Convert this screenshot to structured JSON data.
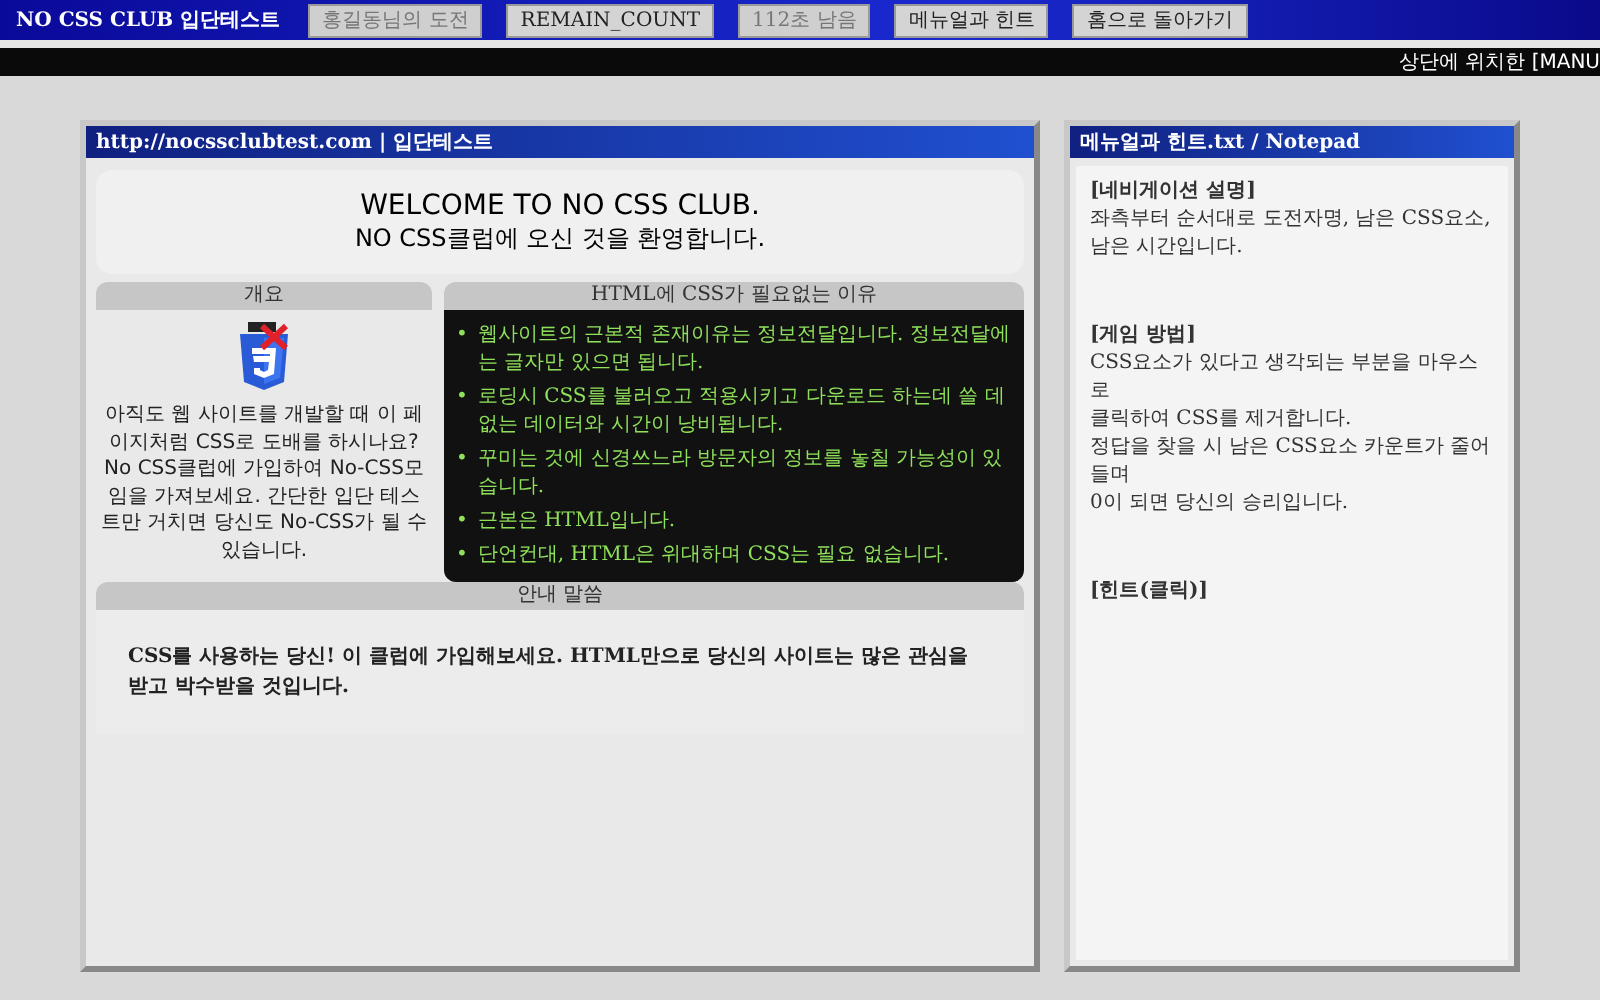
{
  "top_bar": {
    "title": "NO CSS CLUB 입단테스트",
    "buttons": [
      {
        "label": "홍길동님의 도전",
        "disabled": true
      },
      {
        "label": "REMAIN_COUNT",
        "disabled": false
      },
      {
        "label": "112초 남음",
        "disabled": true
      },
      {
        "label": "메뉴얼과 힌트",
        "disabled": false
      },
      {
        "label": "홈으로 돌아가기",
        "disabled": false
      }
    ]
  },
  "marquee": "상단에 위치한 [MANU",
  "main_window": {
    "title": "http://nocssclubtest.com | 입단테스트",
    "welcome": [
      "WELCOME TO NO CSS CLUB.",
      "NO CSS클럽에 오신 것을 환영합니다."
    ],
    "overview": {
      "heading": "개요",
      "text": "아직도 웹 사이트를 개발할 때 이 페이지처럼 CSS로 도배를 하시나요? No CSS클럽에 가입하여 No-CSS모임을 가져보세요. 간단한 입단 테스트만 거치면 당신도 No-CSS가 될 수 있습니다."
    },
    "reasons": {
      "heading": "HTML에 CSS가 필요없는 이유",
      "items": [
        {
          "marker": "•",
          "text": "웹사이트의 근본적 존재이유는 정보전달입니다. 정보전달에는 글자만 있으면 됩니다."
        },
        {
          "marker": "•",
          "text": "로딩시 CSS를 불러오고 적용시키고 다운로드 하는데 쓸 데 없는 데이터와 시간이 낭비됩니다."
        },
        {
          "marker": "•",
          "text": "꾸미는 것에 신경쓰느라 방문자의 정보를 놓칠 가능성이 있습니다."
        },
        {
          "marker": "•",
          "text": "근본은 HTML입니다."
        },
        {
          "marker": "•",
          "text": "단언컨대, HTML은 위대하며 CSS는 필요 없습니다."
        }
      ]
    },
    "notice": {
      "heading": "안내 말씀",
      "text": "CSS를 사용하는 당신! 이 클럽에 가입해보세요. HTML만으로 당신의 사이트는 많은 관심을 받고 박수받을 것입니다."
    }
  },
  "notepad": {
    "title": "메뉴얼과 힌트.txt / Notepad",
    "sections": [
      {
        "heading": "[네비게이션 설명]",
        "lines": [
          "좌측부터 순서대로 도전자명, 남은 CSS요소,",
          "남은 시간입니다."
        ]
      },
      {
        "heading": "[게임 방법]",
        "lines": [
          "CSS요소가 있다고 생각되는 부분을 마우스로",
          "클릭하여 CSS를 제거합니다.",
          "정답을 찾을 시 남은 CSS요소 카운트가 줄어들며",
          "0이 되면 당신의 승리입니다."
        ]
      },
      {
        "heading": "[힌트(클릭)]"
      }
    ]
  }
}
